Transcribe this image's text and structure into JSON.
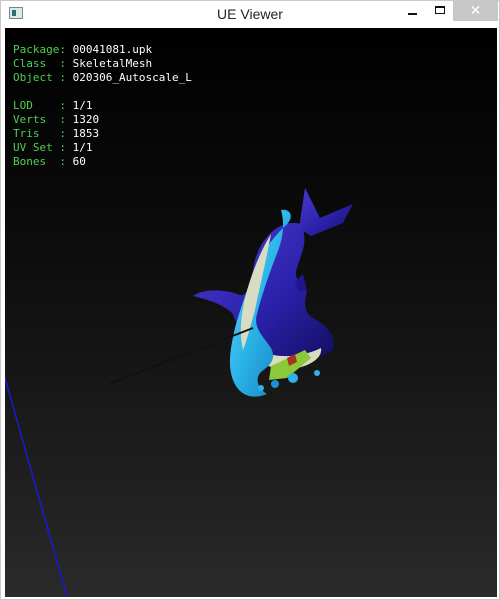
{
  "window": {
    "title": "UE Viewer",
    "close_label": "✕"
  },
  "info": {
    "package_key": "Package:",
    "package_value": "00041081.upk",
    "class_key": "Class  :",
    "class_value": "SkeletalMesh",
    "object_key": "Object :",
    "object_value": "020306_Autoscale_L",
    "lod_key": "LOD    :",
    "lod_value": "1/1",
    "verts_key": "Verts  :",
    "verts_value": "1320",
    "tris_key": "Tris   :",
    "tris_value": "1853",
    "uvset_key": "UV Set :",
    "uvset_value": "1/1",
    "bones_key": "Bones  :",
    "bones_value": "60"
  },
  "colors": {
    "info_key": "#4fd04f",
    "info_value": "#ffffff",
    "mesh_body": "#2a20a8",
    "mesh_fin": "#2bb4e8",
    "mesh_belly": "#d8dcc0",
    "mesh_green": "#8bc83a"
  },
  "icons": {
    "app": "app-icon",
    "minimize": "minimize-icon",
    "maximize": "maximize-icon",
    "close": "close-icon"
  }
}
